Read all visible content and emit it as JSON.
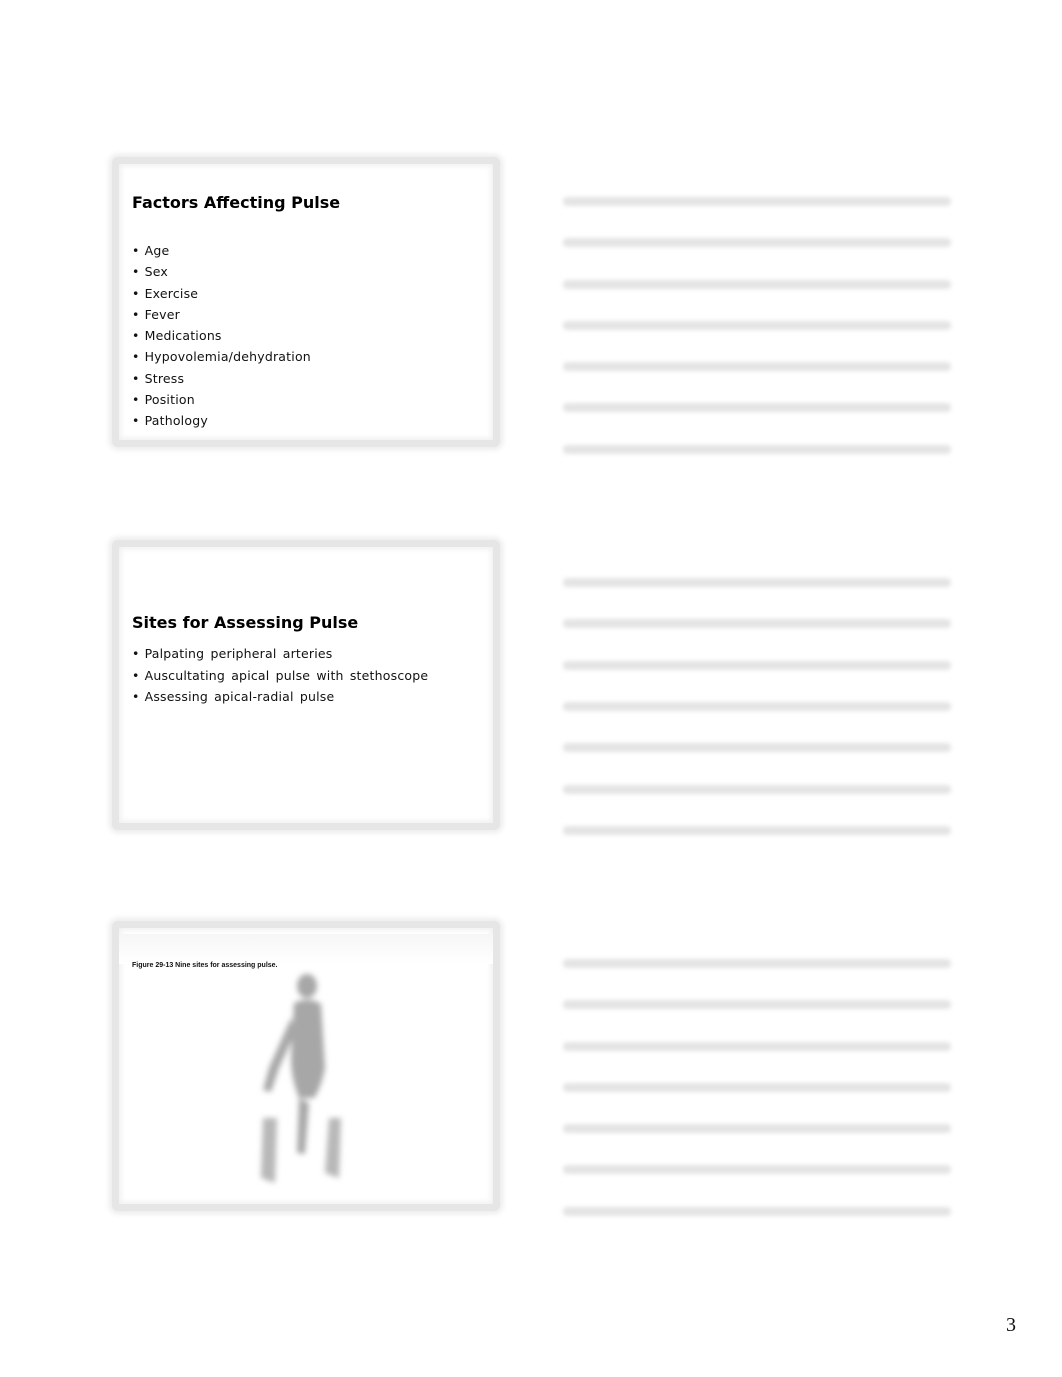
{
  "slides": [
    {
      "title": "Factors Affecting Pulse",
      "bullets": [
        "Age",
        "Sex",
        "Exercise",
        "Fever",
        "Medications",
        "Hypovolemia/dehydration",
        "Stress",
        "Position",
        "Pathology"
      ]
    },
    {
      "title": "Sites for Assessing Pulse",
      "bullets": [
        "Palpating peripheral arteries",
        "Auscultating apical pulse with stethoscope",
        "Assessing apical-radial pulse"
      ]
    },
    {
      "caption": "Figure 29-13   Nine sites for assessing pulse.",
      "image": "human-figure-pulse-sites-illustration"
    }
  ],
  "notes_lines_per_slide": 7,
  "page_number": "3"
}
